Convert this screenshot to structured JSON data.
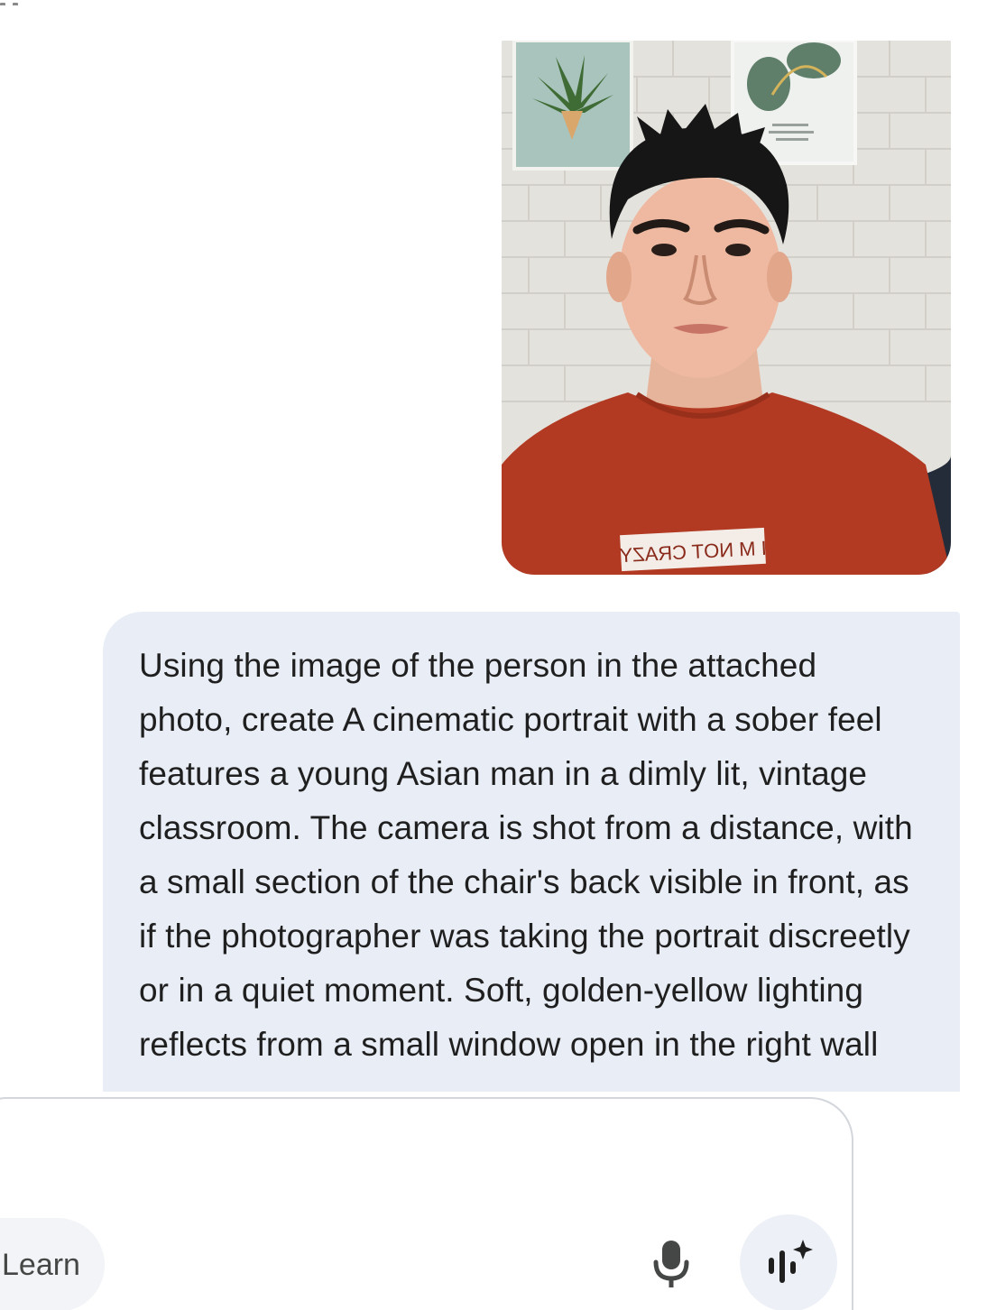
{
  "attachment": {
    "alt": "attached photo",
    "shirt_text": "I M NOT CRAZY"
  },
  "prompt": {
    "text": "Using the image of the person in the attached photo, create A cinematic portrait with a sober feel features a young Asian man in a dimly lit, vintage classroom. The camera is shot from a distance, with a small section of the chair's back visible in front, as if the photographer was taking the portrait discreetly or in a quiet moment. Soft, golden-yellow lighting reflects from a small window open in the right wall"
  },
  "composer": {
    "chip_label": "Learn",
    "mic_icon": "mic-icon",
    "live_icon": "live-sparkle-icon"
  },
  "colors": {
    "bubble": "#e9eef6",
    "text": "#1f1f1f",
    "composer_border": "#d3d6db",
    "shirt": "#b23a22"
  }
}
